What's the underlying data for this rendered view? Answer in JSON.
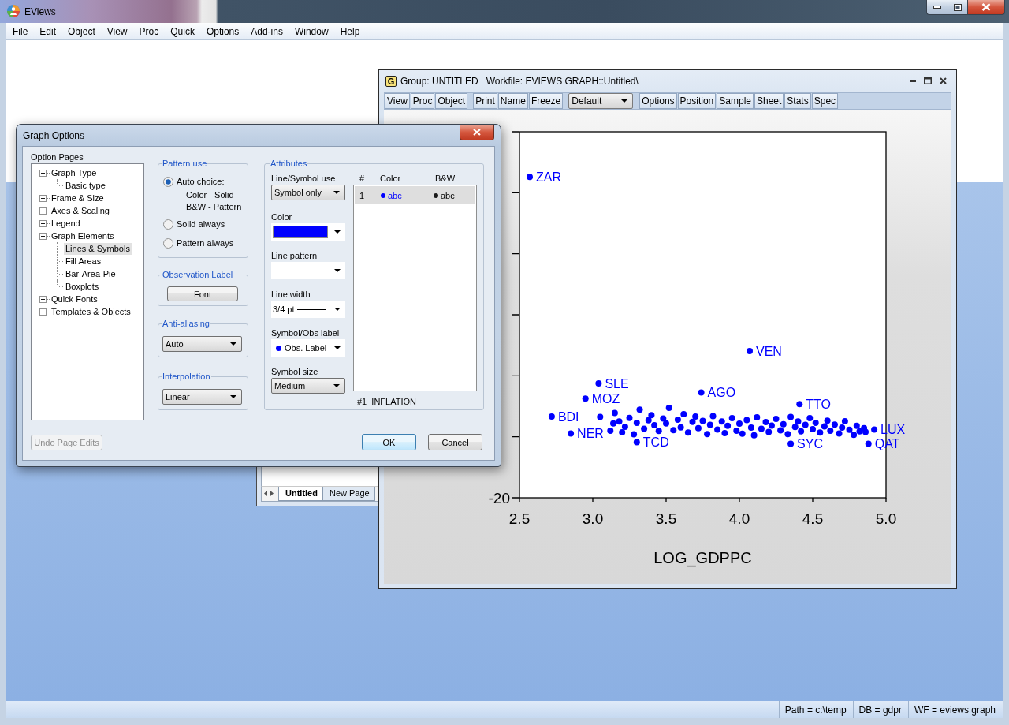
{
  "app": {
    "title": "EViews"
  },
  "menu": [
    "File",
    "Edit",
    "Object",
    "View",
    "Proc",
    "Quick",
    "Options",
    "Add-ins",
    "Window",
    "Help"
  ],
  "workfile_window": {
    "tabs": [
      {
        "label": "Untitled",
        "selected": true
      },
      {
        "label": "New Page",
        "selected": false
      }
    ]
  },
  "group_window": {
    "badge": "G",
    "title": "Group: UNTITLED",
    "workfile": "Workfile: EVIEWS GRAPH::Untitled\\",
    "toolbar": [
      {
        "kind": "buttons",
        "labels": [
          "View",
          "Proc",
          "Object"
        ]
      },
      {
        "kind": "buttons",
        "labels": [
          "Print",
          "Name",
          "Freeze"
        ]
      },
      {
        "kind": "dropdown",
        "value": "Default"
      },
      {
        "kind": "buttons",
        "labels": [
          "Options",
          "Position",
          "Sample",
          "Sheet",
          "Stats",
          "Spec"
        ]
      }
    ],
    "graph": {
      "y_tick_labels": [
        "-20"
      ],
      "x_tick_labels": [
        "2.5",
        "3.0",
        "3.5",
        "4.0",
        "4.5",
        "5.0"
      ],
      "x_axis_title": "LOG_GDPPC",
      "point_labels": [
        "ZAR",
        "VEN",
        "SLE",
        "MOZ",
        "AGO",
        "TTO",
        "BDI",
        "NER",
        "TCD",
        "SYC",
        "QAT",
        "LUX"
      ]
    }
  },
  "dialog": {
    "title": "Graph Options",
    "option_pages": {
      "label": "Option Pages",
      "tree": [
        {
          "label": "Graph Type",
          "expanded": true,
          "selected": false,
          "children": [
            {
              "label": "Basic type",
              "selected": false
            }
          ]
        },
        {
          "label": "Frame & Size",
          "expanded": false,
          "selected": false
        },
        {
          "label": "Axes & Scaling",
          "expanded": false,
          "selected": false
        },
        {
          "label": "Legend",
          "expanded": false,
          "selected": false
        },
        {
          "label": "Graph Elements",
          "expanded": true,
          "selected": false,
          "children": [
            {
              "label": "Lines & Symbols",
              "selected": true
            },
            {
              "label": "Fill Areas",
              "selected": false
            },
            {
              "label": "Bar-Area-Pie",
              "selected": false
            },
            {
              "label": "Boxplots",
              "selected": false
            }
          ]
        },
        {
          "label": "Quick Fonts",
          "expanded": false,
          "selected": false
        },
        {
          "label": "Templates & Objects",
          "expanded": false,
          "selected": false
        }
      ]
    },
    "undo_button": {
      "label": "Undo Page Edits",
      "disabled": true
    },
    "pattern_use": {
      "title": "Pattern use",
      "options": [
        {
          "label": "Auto choice:",
          "selected": true,
          "notes": [
            "Color - Solid",
            "B&W - Pattern"
          ]
        },
        {
          "label": "Solid always",
          "selected": false
        },
        {
          "label": "Pattern always",
          "selected": false
        }
      ]
    },
    "observation_label": {
      "title": "Observation Label",
      "button": "Font"
    },
    "anti_aliasing": {
      "title": "Anti-aliasing",
      "value": "Auto"
    },
    "interpolation": {
      "title": "Interpolation",
      "value": "Linear"
    },
    "attributes": {
      "title": "Attributes",
      "fields": [
        {
          "kind": "dropdown",
          "label": "Line/Symbol use",
          "value": "Symbol only"
        },
        {
          "kind": "color",
          "label": "Color",
          "color": "#0000ff"
        },
        {
          "kind": "line",
          "label": "Line pattern"
        },
        {
          "kind": "line",
          "label": "Line width",
          "value": "3/4 pt"
        },
        {
          "kind": "symbol",
          "label": "Symbol/Obs label",
          "value": "Obs. Label",
          "color": "#0000ff"
        },
        {
          "kind": "dropdown",
          "label": "Symbol size",
          "value": "Medium"
        }
      ],
      "series_list": {
        "columns": [
          "#",
          "Color",
          "B&W"
        ],
        "rows": [
          {
            "number": "1",
            "color": "#0000ff",
            "color_sample": "abc",
            "bw_sample": "abc",
            "selected": true
          }
        ]
      },
      "caption": "#1  INFLATION"
    },
    "buttons": [
      {
        "label": "OK",
        "default": true
      },
      {
        "label": "Cancel",
        "default": false
      }
    ]
  },
  "status_bar": [
    "Path = c:\\temp",
    "DB = gdpr",
    "WF = eviews graph"
  ]
}
